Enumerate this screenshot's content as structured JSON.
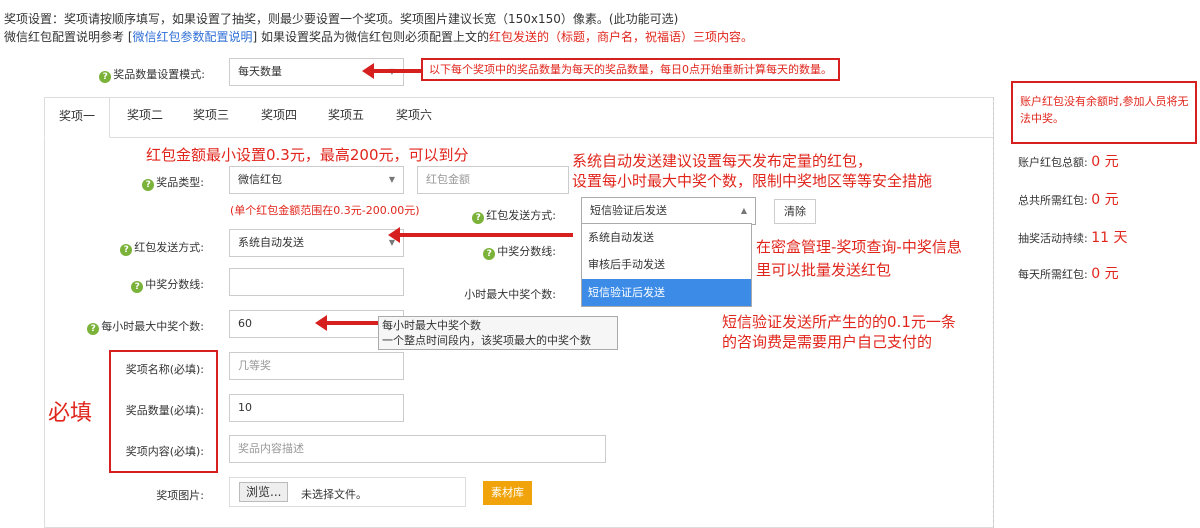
{
  "header": {
    "line1": "奖项设置：奖项请按顺序填写，如果设置了抽奖，则最少要设置一个奖项。奖项图片建议长宽（150x150）像素。(此功能可选)",
    "line2_prefix": "微信红包配置说明参考 [",
    "line2_link": "微信红包参数配置说明",
    "line2_mid": "]    如果设置奖品为微信红包则必须配置上文的",
    "line2_red": "红包发送的（标题，商户名，祝福语）三项内容。"
  },
  "mode": {
    "label": "奖品数量设置模式:",
    "value": "每天数量",
    "note": "以下每个奖项中的奖品数量为每天的奖品数量，每日0点开始重新计算每天的数量。"
  },
  "tabs": [
    "奖项一",
    "奖项二",
    "奖项三",
    "奖项四",
    "奖项五",
    "奖项六"
  ],
  "form": {
    "prize_type_label": "奖品类型:",
    "prize_type_value": "微信红包",
    "amount_placeholder": "红包金额",
    "amount_hint": "(单个红包金额范围在0.3元-200.00元)",
    "send_method_label": "红包发送方式:",
    "send_method_value": "系统自动发送",
    "send_method_right_label": "红包发送方式:",
    "send_method_right_value": "短信验证后发送",
    "clear_button": "清除",
    "dropdown_options": [
      "系统自动发送",
      "审核后手动发送",
      "短信验证后发送"
    ],
    "score_label": "中奖分数线:",
    "score_right_label": "中奖分数线:",
    "hourly_right_label": "小时最大中奖个数:",
    "hourly_label": "每小时最大中奖个数:",
    "hourly_value": "60",
    "tooltip_line1": "每小时最大中奖个数",
    "tooltip_line2": "一个整点时间段内，该奖项最大的中奖个数",
    "name_label": "奖项名称(必填):",
    "name_placeholder": "几等奖",
    "qty_label": "奖品数量(必填):",
    "qty_value": "10",
    "content_label": "奖项内容(必填):",
    "content_placeholder": "奖品内容描述",
    "image_label": "奖项图片:",
    "browse_button": "浏览...",
    "no_file": "未选择文件。",
    "library_button": "素材库"
  },
  "annotations": {
    "min_amount": "红包金额最小设置0.3元，最高200元，可以到分",
    "auto_send_1": "系统自动发送建议设置每天发布定量的红包，",
    "auto_send_2": "设置每小时最大中奖个数，限制中奖地区等等安全措施",
    "manage_1": "在密盒管理-奖项查询-中奖信息",
    "manage_2": "里可以批量发送红包",
    "sms_1": "短信验证发送所产生的的0.1元一条",
    "sms_2": "的咨询费是需要用户自己支付的",
    "required": "必填"
  },
  "sidebar": {
    "warning": "账户红包没有余额时,参加人员将无法中奖。",
    "stats": [
      {
        "label": "账户红包总额:",
        "value": "0 元"
      },
      {
        "label": "总共所需红包:",
        "value": "0 元"
      },
      {
        "label": "抽奖活动持续:",
        "value": "11 天"
      },
      {
        "label": "每天所需红包:",
        "value": "0 元"
      }
    ]
  }
}
